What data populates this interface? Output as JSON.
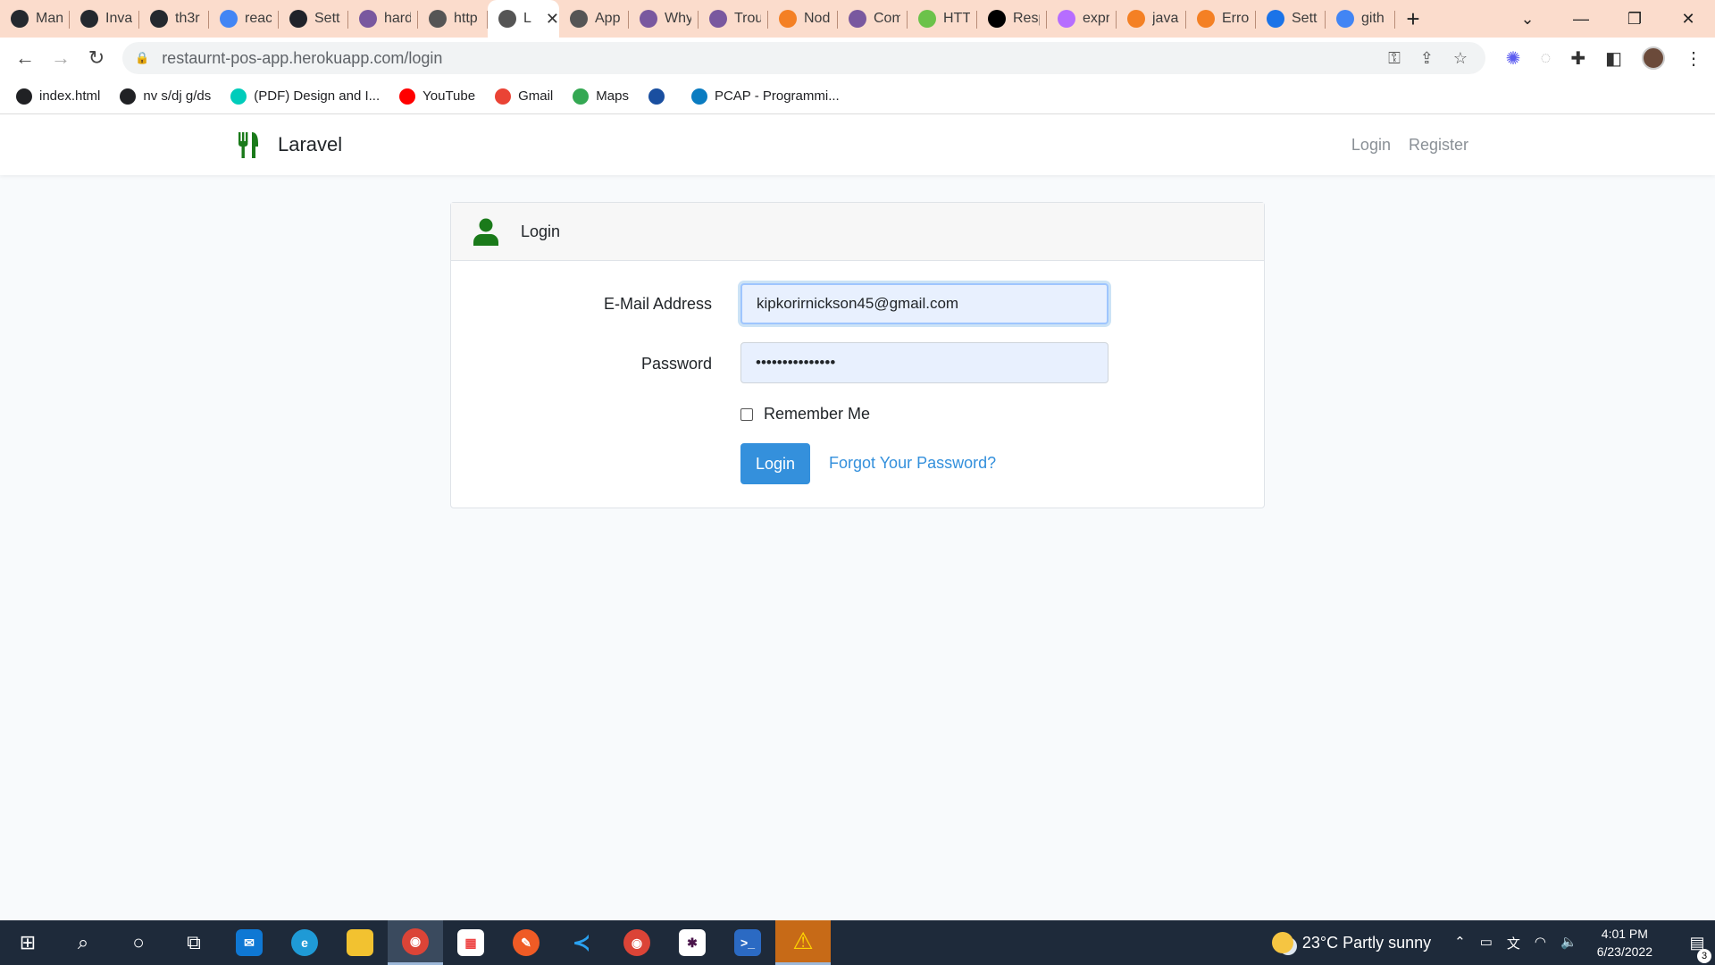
{
  "browser": {
    "tabs": [
      {
        "label": "Man",
        "icon": "github-icon",
        "color": "#24292f"
      },
      {
        "label": "Inva",
        "icon": "github-icon",
        "color": "#24292f"
      },
      {
        "label": "th3r",
        "icon": "github-icon",
        "color": "#24292f"
      },
      {
        "label": "reac",
        "icon": "google-icon",
        "color": "#4285f4"
      },
      {
        "label": "Sett",
        "icon": "react-icon",
        "color": "#20232a"
      },
      {
        "label": "hard",
        "icon": "heroku-icon",
        "color": "#79589f"
      },
      {
        "label": "http",
        "icon": "globe-icon",
        "color": "#555555"
      },
      {
        "label": "L",
        "icon": "globe-icon",
        "color": "#555555",
        "active": true
      },
      {
        "label": "App",
        "icon": "globe-icon",
        "color": "#555555"
      },
      {
        "label": "Why",
        "icon": "heroku-icon",
        "color": "#79589f"
      },
      {
        "label": "Trou",
        "icon": "heroku-icon",
        "color": "#79589f"
      },
      {
        "label": "Nod",
        "icon": "stackoverflow-icon",
        "color": "#f48024"
      },
      {
        "label": "Com",
        "icon": "heroku-icon",
        "color": "#79589f"
      },
      {
        "label": "HTT",
        "icon": "node-icon",
        "color": "#6cc24a"
      },
      {
        "label": "Resp",
        "icon": "medium-icon",
        "color": "#000000"
      },
      {
        "label": "expr",
        "icon": "hexagon-icon",
        "color": "#b66dff"
      },
      {
        "label": "java",
        "icon": "stackoverflow-icon",
        "color": "#f48024"
      },
      {
        "label": "Erro",
        "icon": "stackoverflow-icon",
        "color": "#f48024"
      },
      {
        "label": "Sett",
        "icon": "gear-icon",
        "color": "#1a73e8"
      },
      {
        "label": "gith",
        "icon": "google-icon",
        "color": "#4285f4"
      }
    ],
    "new_tab": "+",
    "url": "restaurnt-pos-app.herokuapp.com/login",
    "bookmarks": [
      {
        "label": "index.html",
        "icon": "globe-icon",
        "color": "#202124"
      },
      {
        "label": "nv s/dj g/ds",
        "icon": "globe-icon",
        "color": "#202124"
      },
      {
        "label": "(PDF) Design and I...",
        "icon": "researchgate-icon",
        "color": "#00ccbb"
      },
      {
        "label": "YouTube",
        "icon": "youtube-icon",
        "color": "#ff0000"
      },
      {
        "label": "Gmail",
        "icon": "gmail-icon",
        "color": "#ea4335"
      },
      {
        "label": "Maps",
        "icon": "maps-pin-icon",
        "color": "#34a853"
      },
      {
        "label": "",
        "icon": "bookmark-app-icon",
        "color": "#1a4fa0"
      },
      {
        "label": "PCAP - Programmi...",
        "icon": "pcap-icon",
        "color": "#0a7cc1"
      }
    ]
  },
  "app": {
    "brand": "Laravel",
    "nav_login": "Login",
    "nav_register": "Register",
    "accent": "#3490dc",
    "brand_color": "#1a7a1a"
  },
  "login_card": {
    "title": "Login",
    "email_label": "E-Mail Address",
    "email_value": "kipkorirnickson45@gmail.com",
    "password_label": "Password",
    "password_value": "•••••••••••••••",
    "remember_label": "Remember Me",
    "login_button": "Login",
    "forgot_link": "Forgot Your Password?"
  },
  "taskbar": {
    "weather": "23°C  Partly sunny",
    "time": "4:01 PM",
    "date": "6/23/2022",
    "notification_count": "3"
  }
}
